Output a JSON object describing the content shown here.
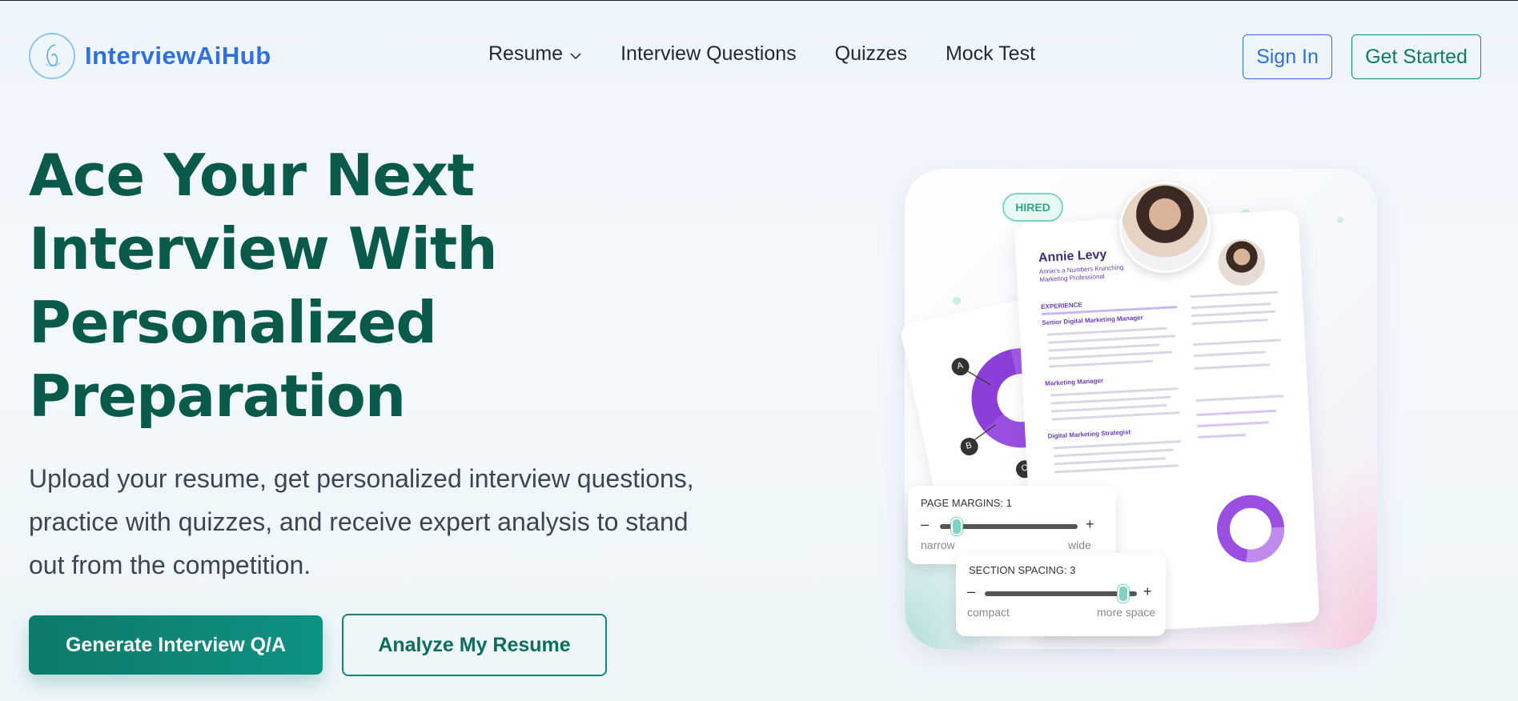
{
  "header": {
    "brand_name": "InterviewAiHub",
    "nav": [
      {
        "label": "Resume",
        "has_dropdown": true
      },
      {
        "label": "Interview Questions"
      },
      {
        "label": "Quizzes"
      },
      {
        "label": "Mock Test"
      }
    ],
    "sign_in_label": "Sign In",
    "get_started_label": "Get Started"
  },
  "hero": {
    "title_lines": [
      "Ace Your Next",
      "Interview With",
      "Personalized",
      "Preparation"
    ],
    "subtitle_lines": [
      "Upload your resume, get personalized interview questions,",
      "practice with quizzes, and receive expert analysis to stand",
      "out from the competition."
    ],
    "primary_button": "Generate Interview Q/A",
    "secondary_button": "Analyze My Resume"
  },
  "illustration": {
    "badge": "HIRED",
    "resume_name": "Annie Levy",
    "resume_role": "Annie's a Numbers Krunching Marketing Professional",
    "pie_labels": [
      "A",
      "B",
      "C"
    ],
    "margins_title": "PAGE MARGINS: 1",
    "margins_min": "narrow",
    "margins_max": "wide",
    "spacing_title": "SECTION SPACING: 3",
    "spacing_min": "compact",
    "spacing_max": "more space"
  },
  "colors": {
    "brand_blue": "#2f6fe0",
    "heading_green": "#0a5a4c",
    "primary_button": "#0d7a6a",
    "accent_purple": "#8b3fd8"
  }
}
